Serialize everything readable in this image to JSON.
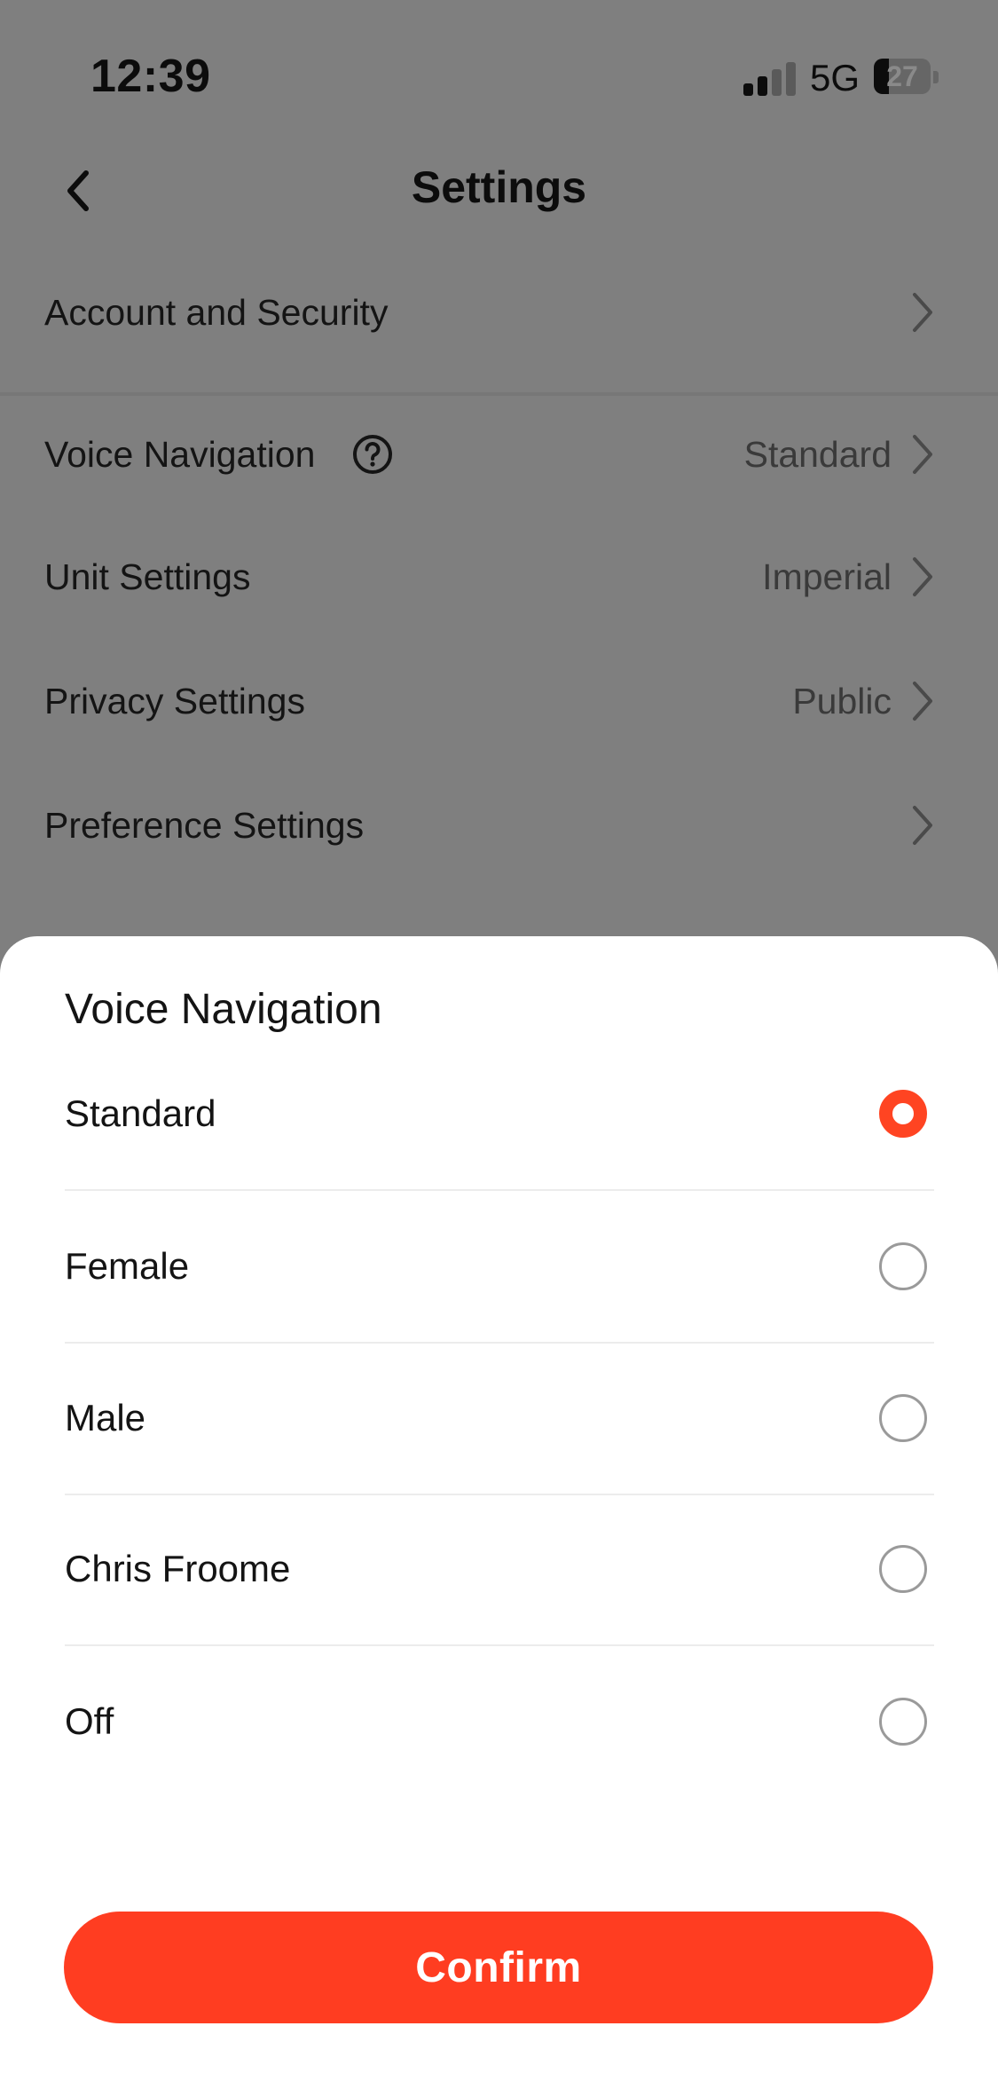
{
  "status_bar": {
    "time": "12:39",
    "network": "5G",
    "battery": "27"
  },
  "header": {
    "title": "Settings",
    "back_icon": "chevron-left-icon"
  },
  "settings": {
    "rows": [
      {
        "label": "Account and Security",
        "value": ""
      },
      {
        "label": "Voice Navigation",
        "value": "Standard"
      },
      {
        "label": "Unit Settings",
        "value": "Imperial"
      },
      {
        "label": "Privacy Settings",
        "value": "Public"
      },
      {
        "label": "Preference Settings",
        "value": ""
      }
    ]
  },
  "sheet": {
    "title": "Voice Navigation",
    "options": [
      {
        "label": "Standard",
        "selected": true
      },
      {
        "label": "Female",
        "selected": false
      },
      {
        "label": "Male",
        "selected": false
      },
      {
        "label": "Chris Froome",
        "selected": false
      },
      {
        "label": "Off",
        "selected": false
      }
    ],
    "confirm_label": "Confirm"
  },
  "colors": {
    "accent": "#ff3d21",
    "overlay": "#7f7f7f",
    "sheet_bg": "#ffffff"
  }
}
